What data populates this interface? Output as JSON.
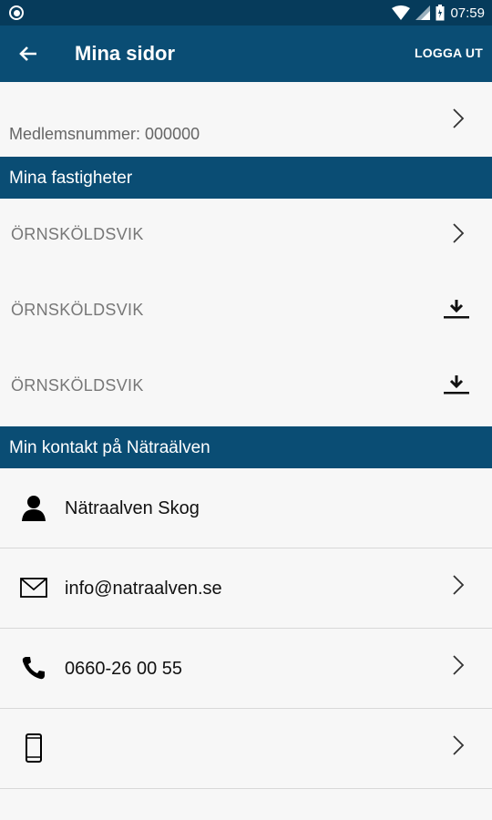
{
  "status_bar": {
    "time": "07:59"
  },
  "header": {
    "title": "Mina sidor",
    "logout_label": "LOGGA UT"
  },
  "member": {
    "label": "Medlemsnummer: 000000"
  },
  "properties_section": {
    "title": "Mina fastigheter"
  },
  "properties": [
    {
      "name": "ÖRNSKÖLDSVIK",
      "action_icon": "chevron-right-icon"
    },
    {
      "name": "ÖRNSKÖLDSVIK",
      "action_icon": "download-icon"
    },
    {
      "name": "ÖRNSKÖLDSVIK",
      "action_icon": "download-icon"
    }
  ],
  "contact_section": {
    "title": "Min kontakt på Nätraälven"
  },
  "contacts": [
    {
      "icon": "person-icon",
      "text": "Nätraalven Skog"
    },
    {
      "icon": "mail-icon",
      "text": "info@natraalven.se"
    },
    {
      "icon": "phone-icon",
      "text": "0660-26 00 55"
    },
    {
      "icon": "mobile-icon",
      "text": ""
    }
  ],
  "colors": {
    "header": "#0a4d74",
    "status_bar": "#063b5b",
    "background": "#f7f7f7"
  }
}
